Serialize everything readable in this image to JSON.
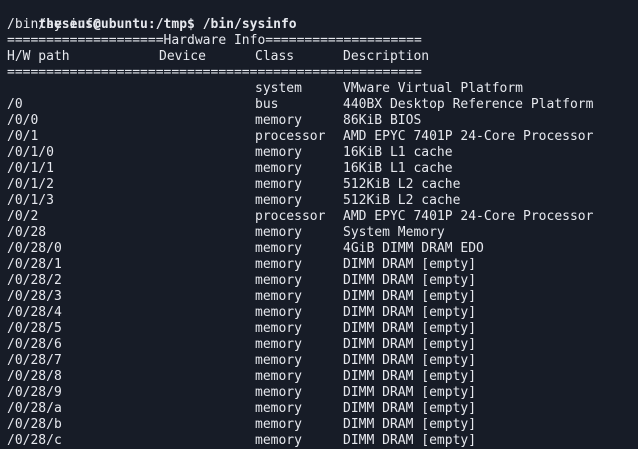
{
  "terminal": {
    "prompt_user_host": "theseus@ubuntu",
    "prompt_path": ":/tmp$ ",
    "command": "/bin/sysinfo",
    "echo_line": "/bin/sysinfo",
    "banner": "====================Hardware Info====================",
    "header": {
      "hw_path": "H/W path",
      "device": "Device",
      "class": "Class",
      "description": "Description"
    },
    "separator": "=====================================================",
    "rows": [
      {
        "path": "",
        "device": "",
        "class": "system",
        "description": "VMware Virtual Platform"
      },
      {
        "path": "/0",
        "device": "",
        "class": "bus",
        "description": "440BX Desktop Reference Platform"
      },
      {
        "path": "/0/0",
        "device": "",
        "class": "memory",
        "description": "86KiB BIOS"
      },
      {
        "path": "/0/1",
        "device": "",
        "class": "processor",
        "description": "AMD EPYC 7401P 24-Core Processor"
      },
      {
        "path": "/0/1/0",
        "device": "",
        "class": "memory",
        "description": "16KiB L1 cache"
      },
      {
        "path": "/0/1/1",
        "device": "",
        "class": "memory",
        "description": "16KiB L1 cache"
      },
      {
        "path": "/0/1/2",
        "device": "",
        "class": "memory",
        "description": "512KiB L2 cache"
      },
      {
        "path": "/0/1/3",
        "device": "",
        "class": "memory",
        "description": "512KiB L2 cache"
      },
      {
        "path": "/0/2",
        "device": "",
        "class": "processor",
        "description": "AMD EPYC 7401P 24-Core Processor"
      },
      {
        "path": "/0/28",
        "device": "",
        "class": "memory",
        "description": "System Memory"
      },
      {
        "path": "/0/28/0",
        "device": "",
        "class": "memory",
        "description": "4GiB DIMM DRAM EDO"
      },
      {
        "path": "/0/28/1",
        "device": "",
        "class": "memory",
        "description": "DIMM DRAM [empty]"
      },
      {
        "path": "/0/28/2",
        "device": "",
        "class": "memory",
        "description": "DIMM DRAM [empty]"
      },
      {
        "path": "/0/28/3",
        "device": "",
        "class": "memory",
        "description": "DIMM DRAM [empty]"
      },
      {
        "path": "/0/28/4",
        "device": "",
        "class": "memory",
        "description": "DIMM DRAM [empty]"
      },
      {
        "path": "/0/28/5",
        "device": "",
        "class": "memory",
        "description": "DIMM DRAM [empty]"
      },
      {
        "path": "/0/28/6",
        "device": "",
        "class": "memory",
        "description": "DIMM DRAM [empty]"
      },
      {
        "path": "/0/28/7",
        "device": "",
        "class": "memory",
        "description": "DIMM DRAM [empty]"
      },
      {
        "path": "/0/28/8",
        "device": "",
        "class": "memory",
        "description": "DIMM DRAM [empty]"
      },
      {
        "path": "/0/28/9",
        "device": "",
        "class": "memory",
        "description": "DIMM DRAM [empty]"
      },
      {
        "path": "/0/28/a",
        "device": "",
        "class": "memory",
        "description": "DIMM DRAM [empty]"
      },
      {
        "path": "/0/28/b",
        "device": "",
        "class": "memory",
        "description": "DIMM DRAM [empty]"
      },
      {
        "path": "/0/28/c",
        "device": "",
        "class": "memory",
        "description": "DIMM DRAM [empty]"
      }
    ]
  },
  "colors": {
    "background": "#171c27",
    "foreground": "#e6e8ee"
  }
}
